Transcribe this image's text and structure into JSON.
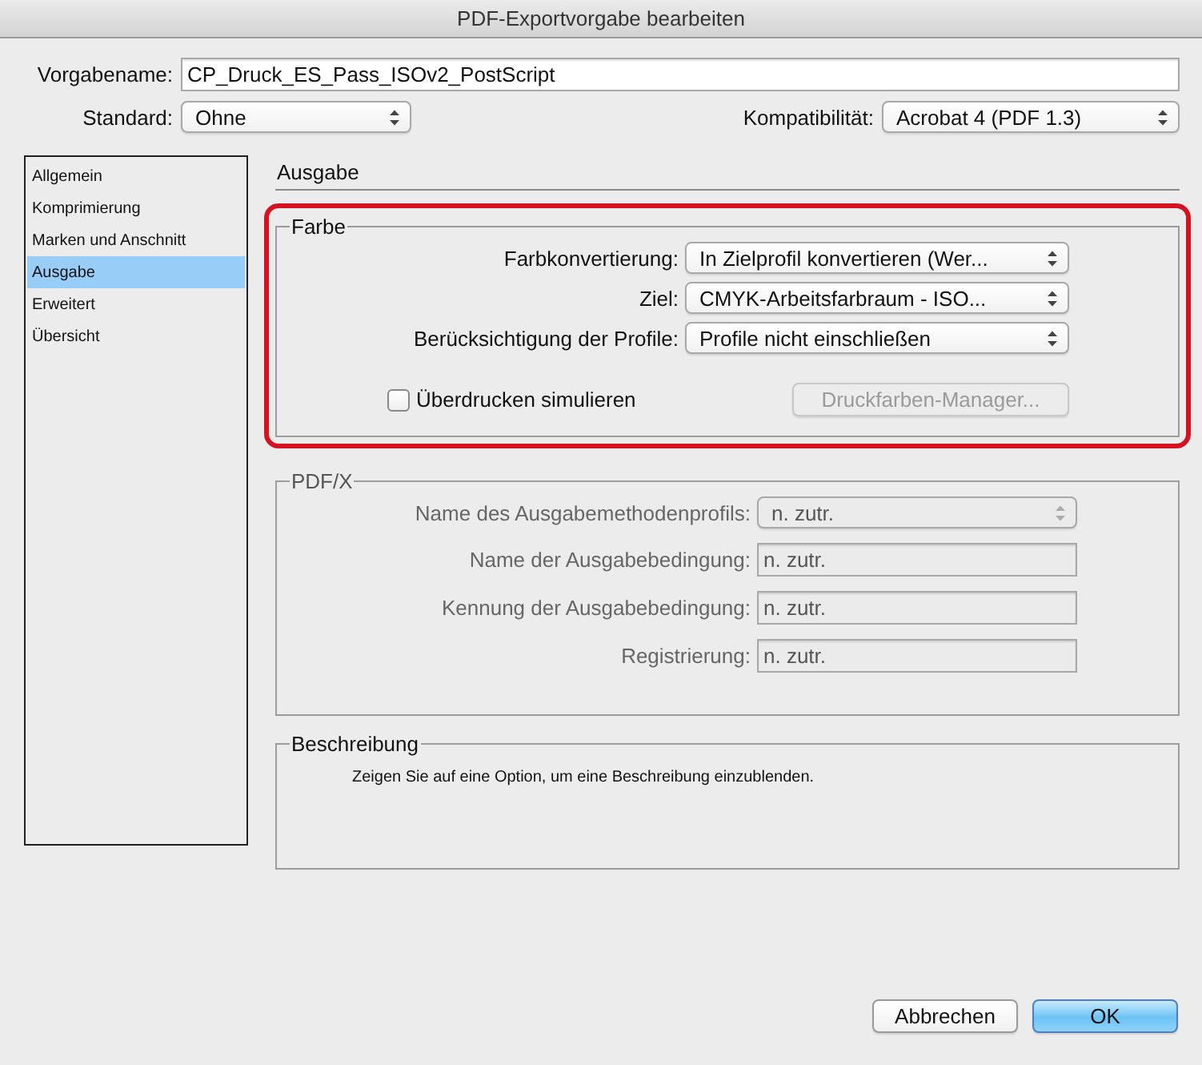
{
  "window": {
    "title": "PDF-Exportvorgabe bearbeiten"
  },
  "preset_name": {
    "label": "Vorgabename:",
    "value": "CP_Druck_ES_Pass_ISOv2_PostScript"
  },
  "standard": {
    "label": "Standard:",
    "value": "Ohne"
  },
  "compatibility": {
    "label": "Kompatibilität:",
    "value": "Acrobat 4 (PDF 1.3)"
  },
  "sidebar": {
    "items": [
      {
        "label": "Allgemein",
        "selected": false
      },
      {
        "label": "Komprimierung",
        "selected": false
      },
      {
        "label": "Marken und Anschnitt",
        "selected": false
      },
      {
        "label": "Ausgabe",
        "selected": true
      },
      {
        "label": "Erweitert",
        "selected": false
      },
      {
        "label": "Übersicht",
        "selected": false
      }
    ]
  },
  "section_title": "Ausgabe",
  "color_group": {
    "title": "Farbe",
    "highlighted": true,
    "rows": [
      {
        "label": "Farbkonvertierung:",
        "value": "In Zielprofil konvertieren (Wer..."
      },
      {
        "label": "Ziel:",
        "value": "CMYK-Arbeitsfarbraum - ISO..."
      },
      {
        "label": "Berücksichtigung der Profile:",
        "value": "Profile nicht einschließen"
      }
    ],
    "overprint": {
      "label": "Überdrucken simulieren",
      "checked": false
    },
    "ink_manager": {
      "label": "Druckfarben-Manager...",
      "disabled": true
    }
  },
  "pdfx_group": {
    "title": "PDF/X",
    "disabled": true,
    "rows": [
      {
        "kind": "select",
        "label": "Name des Ausgabemethodenprofils:",
        "value": "n. zutr."
      },
      {
        "kind": "field",
        "label": "Name der Ausgabebedingung:",
        "value": "n. zutr."
      },
      {
        "kind": "field",
        "label": "Kennung der Ausgabebedingung:",
        "value": "n. zutr."
      },
      {
        "kind": "field",
        "label": "Registrierung:",
        "value": "n. zutr."
      }
    ]
  },
  "description": {
    "title": "Beschreibung",
    "text": "Zeigen Sie auf eine Option, um eine Beschreibung einzublenden."
  },
  "buttons": [
    {
      "label": "Abbrechen",
      "default": false
    },
    {
      "label": "OK",
      "default": true
    }
  ]
}
